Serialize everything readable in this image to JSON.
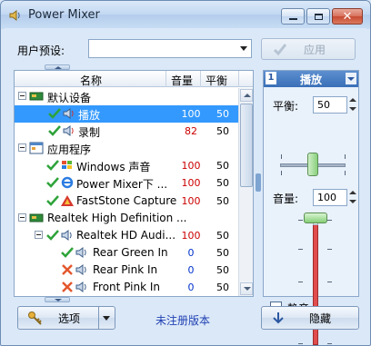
{
  "window": {
    "title": "Power Mixer"
  },
  "preset": {
    "label": "用户预设:",
    "value": "",
    "apply_label": "应用"
  },
  "table": {
    "headers": {
      "name": "名称",
      "volume": "音量",
      "balance": "平衡"
    },
    "rows": [
      {
        "name": "默认设备",
        "volume": "",
        "balance": ""
      },
      {
        "name": "播放",
        "volume": "100",
        "balance": "50"
      },
      {
        "name": "录制",
        "volume": "82",
        "balance": "50"
      },
      {
        "name": "应用程序",
        "volume": "",
        "balance": ""
      },
      {
        "name": "Windows 声音",
        "volume": "100",
        "balance": "50"
      },
      {
        "name": "Power Mixer下 ...",
        "volume": "100",
        "balance": "50"
      },
      {
        "name": "FastStone Capture",
        "volume": "100",
        "balance": "50"
      },
      {
        "name": "Realtek High Definition ...",
        "volume": "",
        "balance": ""
      },
      {
        "name": "Realtek HD Audi...",
        "volume": "100",
        "balance": "50"
      },
      {
        "name": "Rear Green In",
        "volume": "0",
        "balance": "50"
      },
      {
        "name": "Rear Pink In",
        "volume": "0",
        "balance": "50"
      },
      {
        "name": "Front Pink In",
        "volume": "0",
        "balance": "50"
      }
    ]
  },
  "right_panel": {
    "index": "1",
    "title": "播放",
    "balance_label": "平衡:",
    "balance_value": "50",
    "volume_label": "音量:",
    "volume_value": "100",
    "mute_label": "静音"
  },
  "bottom": {
    "options_label": "选项",
    "unregistered": "未注册版本",
    "hide_label": "隐藏"
  },
  "colors": {
    "selection": "#3399ff",
    "volume_red": "#cc0000",
    "volume_blue": "#0033cc",
    "link": "#1f3fb3"
  }
}
